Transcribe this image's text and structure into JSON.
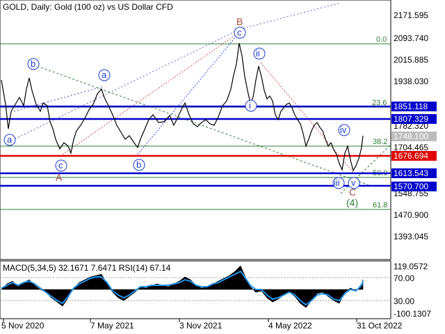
{
  "header": {
    "title": "GOLD, Daily:  Gold (100 oz) vs US Dollar CFD"
  },
  "price_axis": {
    "ticks": [
      "2171.595",
      "2093.740",
      "2015.885",
      "1938.030",
      "1782.320",
      "1704.465",
      "1548.755",
      "1470.900",
      "1393.045"
    ],
    "tags": [
      {
        "label": "1851.118",
        "kind": "blue"
      },
      {
        "label": "1807.329",
        "kind": "blue"
      },
      {
        "label": "1748.100",
        "kind": "gray"
      },
      {
        "label": "1676.694",
        "kind": "red"
      },
      {
        "label": "1613.543",
        "kind": "blue"
      },
      {
        "label": "1570.700",
        "kind": "blue"
      }
    ]
  },
  "fibonacci": [
    "0.0",
    "23.6",
    "38.2",
    "50.0",
    "61.8"
  ],
  "wave_labels": {
    "circled": [
      "a",
      "b",
      "a",
      "c",
      "b",
      "c",
      "ii",
      "i",
      "iv",
      "iii",
      "v"
    ],
    "letters": [
      "B",
      "A",
      "C"
    ],
    "degree": "(4)"
  },
  "indicator": {
    "label": "MACD(5,34,5) 32.1671 7.6471 RSI(14) 67.14",
    "ticks": [
      "119.0572",
      "70.00",
      "30.00",
      "-100.1307"
    ]
  },
  "time_axis": {
    "ticks": [
      "5 Nov 2020",
      "7 May 2021",
      "3 Nov 2021",
      "4 May 2022",
      "31 Oct 2022"
    ]
  },
  "colors": {
    "level_blue": "#0000cc",
    "level_red": "#e00000",
    "level_gray": "#bdbdbd",
    "fib": "#2e7d32",
    "wave_blue": "#1a3ccf",
    "wave_brown": "#a34a3a",
    "macd_line": "#2196f3"
  }
}
